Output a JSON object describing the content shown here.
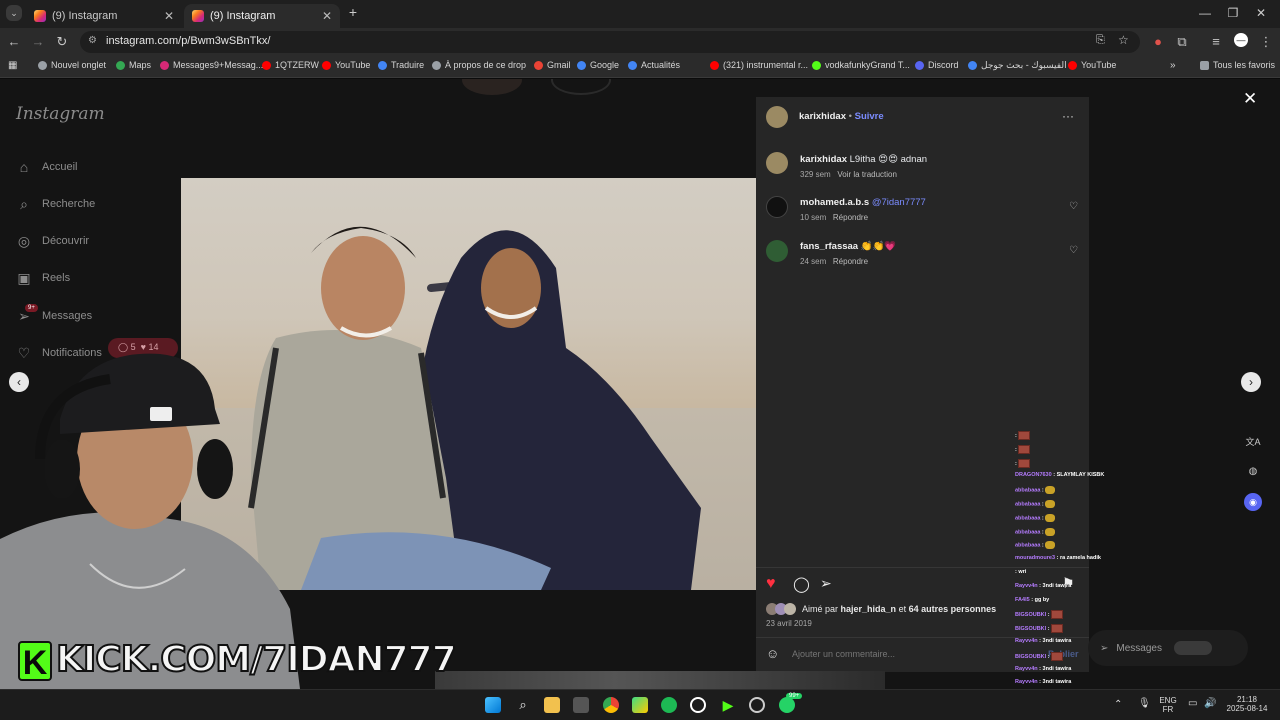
{
  "browser": {
    "tabs": [
      {
        "title": "(9) Instagram"
      },
      {
        "title": "(9) Instagram"
      }
    ],
    "url": "instagram.com/p/Bwm3wSBnTkx/",
    "bookmarks": [
      {
        "label": "Nouvel onglet",
        "color": "#9aa0a6"
      },
      {
        "label": "Maps",
        "color": "#34a853"
      },
      {
        "label": "Messages9+Messag...",
        "color": "#d62976"
      },
      {
        "label": "1QTZERW",
        "color": "#ff0000"
      },
      {
        "label": "YouTube",
        "color": "#ff0000"
      },
      {
        "label": "Traduire",
        "color": "#4285f4"
      },
      {
        "label": "À propos de ce drop",
        "color": "#9aa0a6"
      },
      {
        "label": "Gmail",
        "color": "#ea4335"
      },
      {
        "label": "Google",
        "color": "#4285f4"
      },
      {
        "label": "Actualités",
        "color": "#4285f4"
      },
      {
        "label": "(321) instrumental r...",
        "color": "#ff0000"
      },
      {
        "label": "vodkafunkyGrand T...",
        "color": "#53fc18"
      },
      {
        "label": "Discord",
        "color": "#5865f2"
      },
      {
        "label": "الفيسبوك - بحث جوجل",
        "color": "#4285f4"
      },
      {
        "label": "YouTube",
        "color": "#ff0000"
      }
    ],
    "all_bookmarks": "Tous les favoris"
  },
  "instagram": {
    "logo": "Instagram",
    "nav": [
      {
        "label": "Accueil",
        "icon": "home-icon",
        "glyph": "⌂"
      },
      {
        "label": "Recherche",
        "icon": "search-icon",
        "glyph": "⌕"
      },
      {
        "label": "Découvrir",
        "icon": "compass-icon",
        "glyph": "◎"
      },
      {
        "label": "Reels",
        "icon": "reels-icon",
        "glyph": "▣"
      },
      {
        "label": "Messages",
        "icon": "messages-icon",
        "glyph": "➢"
      },
      {
        "label": "Notifications",
        "icon": "heart-icon",
        "glyph": "♡"
      }
    ],
    "notif_badge": "9+",
    "activity_pill": {
      "comments": "5",
      "likes": "14"
    },
    "post": {
      "author": "karixhidax",
      "follow": "Suivre",
      "caption_user": "karixhidax",
      "caption_text": "L9itha 😍😍 adnan",
      "caption_time": "329 sem",
      "see_translation": "Voir la traduction",
      "comments": [
        {
          "user": "mohamed.a.b.s",
          "text": "@7idan7777",
          "time": "10 sem",
          "reply": "Répondre"
        },
        {
          "user": "fans_rfassaa",
          "text": "👏👏💗",
          "time": "24 sem",
          "reply": "Répondre"
        }
      ],
      "liked_by_prefix": "Aimé par",
      "liked_by_user": "hajer_hida_n",
      "liked_by_suffix": "et",
      "liked_by_others": "64 autres personnes",
      "date": "23 avril 2019",
      "add_comment_placeholder": "Ajouter un commentaire...",
      "publish": "Publier"
    },
    "messages_dock": "Messages"
  },
  "overlay": {
    "kick_label": "KICK.COM/7IDAN777",
    "kick_letter": "K",
    "chat": [
      {
        "user": "",
        "msg": "",
        "kind": "pic"
      },
      {
        "user": "",
        "msg": "",
        "kind": "pic"
      },
      {
        "user": "",
        "msg": "",
        "kind": "pic"
      },
      {
        "user": "DRAGON7630",
        "msg": "SLAYMLAY KISBK",
        "kind": "text"
      },
      {
        "user": "abbabaaa",
        "msg": "",
        "kind": "emo"
      },
      {
        "user": "abbabaaa",
        "msg": "",
        "kind": "emo"
      },
      {
        "user": "abbabaaa",
        "msg": "",
        "kind": "emo"
      },
      {
        "user": "abbabaaa",
        "msg": "",
        "kind": "emo"
      },
      {
        "user": "abbabaaa",
        "msg": "",
        "kind": "emo"
      },
      {
        "user": "mouradmoure3",
        "msg": "ra zamela hadik",
        "kind": "text"
      },
      {
        "user": "",
        "msg": "wri",
        "kind": "text"
      },
      {
        "user": "Rayvv4n",
        "msg": "3ndi tawira",
        "kind": "text"
      },
      {
        "user": "FA4I5",
        "msg": "gg by",
        "kind": "text"
      },
      {
        "user": "BIGSOUBKI",
        "msg": "",
        "kind": "pic"
      },
      {
        "user": "BIGSOUBKI",
        "msg": "",
        "kind": "pic"
      },
      {
        "user": "Rayvv4n",
        "msg": "3ndi tawira",
        "kind": "text"
      },
      {
        "user": "BIGSOUBKI",
        "msg": "",
        "kind": "pic"
      },
      {
        "user": "Rayvv4n",
        "msg": "3ndi tawira",
        "kind": "text"
      },
      {
        "user": "Rayvv4n",
        "msg": "3ndi tawira",
        "kind": "text"
      }
    ]
  },
  "taskbar": {
    "lang": "ENG",
    "lang_sub": "FR",
    "time": "21:18",
    "date": "2025-08-14",
    "whatsapp_badge": "99+"
  },
  "colors": {
    "accent_blue": "#0095f6",
    "like_red": "#ff3040",
    "kick_green": "#53fc18"
  }
}
